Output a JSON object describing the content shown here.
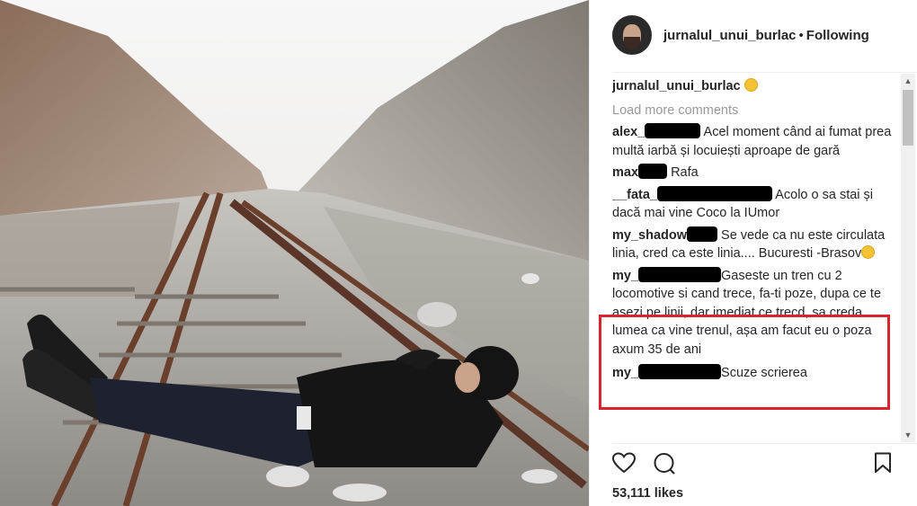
{
  "post": {
    "username": "jurnalul_unui_burlac",
    "separator": "•",
    "follow_status": "Following",
    "caption_username": "jurnalul_unui_burlac",
    "caption_emoji": "😔",
    "load_more": "Load more comments",
    "likes": "53,111 likes"
  },
  "comments": [
    {
      "user": "alex_",
      "text": "Acel moment când ai fumat prea multă iarbă și locuiești aproape de gară"
    },
    {
      "user": "max",
      "text": "Rafa"
    },
    {
      "user": "__fata_",
      "text": "Acolo o sa stai și dacă mai vine Coco la IUmor"
    },
    {
      "user": "my_shadow",
      "text": "Se vede ca nu este circulata linia, cred ca este linia.... Bucuresti -Brasov",
      "emoji": "😆"
    },
    {
      "user": "my_",
      "text": "Gaseste un tren cu 2 locomotive si cand trece, fa-ti poze, dupa ce te asezi pe linii, dar imediat ce trecd, sa creda lumea ca vine trenul, așa am facut eu o poza axum 35 de ani"
    },
    {
      "user": "my_",
      "text": "Scuze scrierea"
    }
  ],
  "icons": {
    "like": "heart-icon",
    "comment": "comment-icon",
    "save": "bookmark-icon"
  },
  "colors": {
    "highlight": "#d9242e",
    "link_muted": "#999999"
  }
}
